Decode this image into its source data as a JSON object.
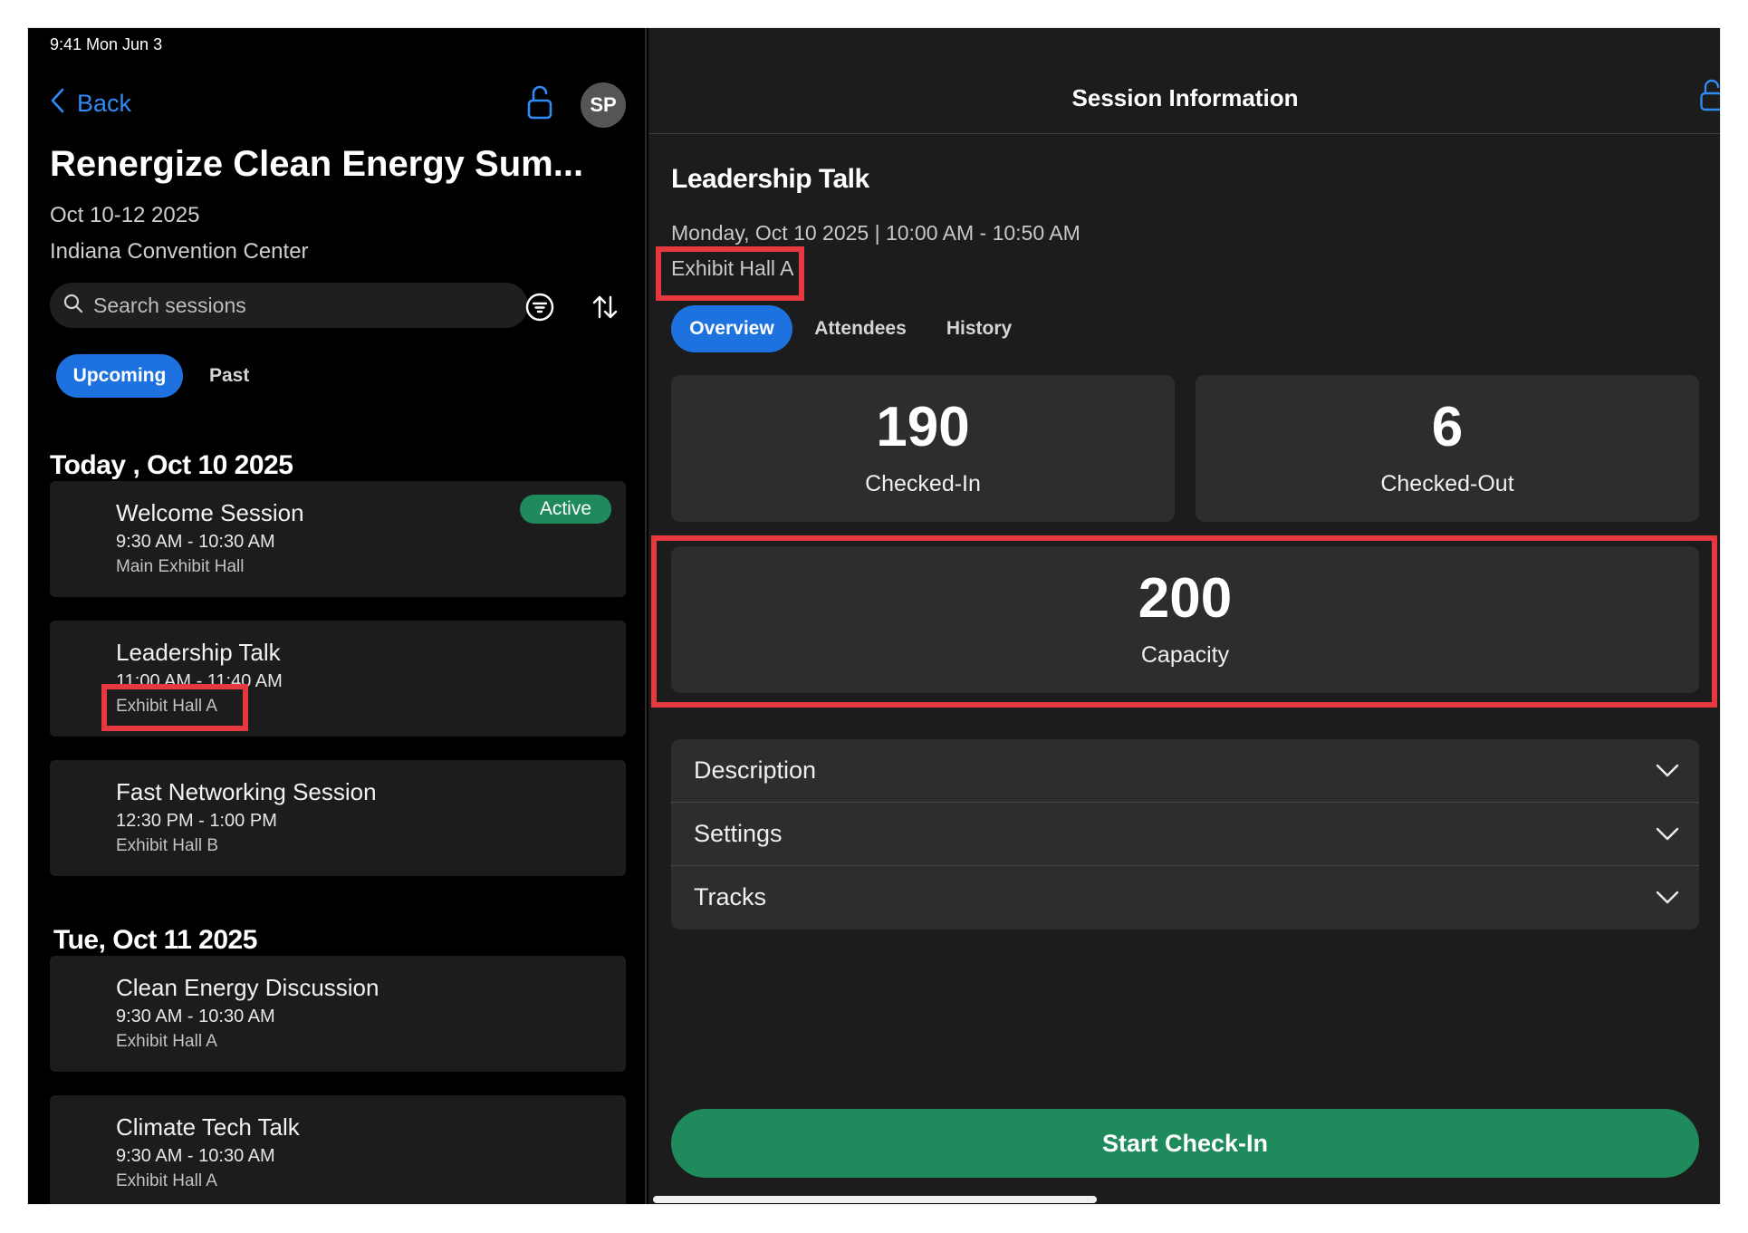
{
  "status_bar": {
    "time": "9:41  Mon Jun 3"
  },
  "left_header": {
    "back_label": "Back",
    "avatar_initials": "SP"
  },
  "event": {
    "title": "Renergize Clean Energy Sum...",
    "dates": "Oct 10-12 2025",
    "venue": "Indiana Convention Center"
  },
  "search": {
    "placeholder": "Search sessions"
  },
  "segments": {
    "upcoming": "Upcoming",
    "past": "Past"
  },
  "days": [
    {
      "header": "Today , Oct 10 2025",
      "sessions": [
        {
          "title": "Welcome Session",
          "time": "9:30 AM - 10:30 AM",
          "room": "Main Exhibit Hall",
          "badge": "Active"
        },
        {
          "title": "Leadership Talk",
          "time": "11:00 AM - 11:40 AM",
          "room": "Exhibit Hall A"
        },
        {
          "title": "Fast Networking Session",
          "time": "12:30 PM - 1:00 PM",
          "room": "Exhibit Hall B"
        }
      ]
    },
    {
      "header": "Tue,  Oct 11 2025",
      "sessions": [
        {
          "title": "Clean Energy Discussion",
          "time": "9:30 AM - 10:30 AM",
          "room": "Exhibit Hall A"
        },
        {
          "title": "Climate Tech Talk",
          "time": "9:30 AM - 10:30 AM",
          "room": "Exhibit Hall A"
        }
      ]
    }
  ],
  "detail": {
    "header_title": "Session Information",
    "session_title": "Leadership Talk",
    "when": "Monday, Oct 10 2025 | 10:00 AM - 10:50 AM",
    "room": "Exhibit Hall A",
    "tabs": [
      "Overview",
      "Attendees",
      "History"
    ],
    "stats": {
      "checked_in": {
        "value": "190",
        "label": "Checked-In"
      },
      "checked_out": {
        "value": "6",
        "label": "Checked-Out"
      },
      "capacity": {
        "value": "200",
        "label": "Capacity"
      }
    },
    "sections": [
      "Description",
      "Settings",
      "Tracks"
    ],
    "primary_action": "Start Check-In"
  },
  "colors": {
    "accent_blue": "#1d72e0",
    "link_blue": "#2f8bf5",
    "success_green": "#1f8a5c",
    "highlight_red": "#e8383f"
  },
  "icons": [
    "chevron-left-icon",
    "unlock-icon",
    "search-icon",
    "filter-icon",
    "sort-icon",
    "chevron-down-icon"
  ]
}
